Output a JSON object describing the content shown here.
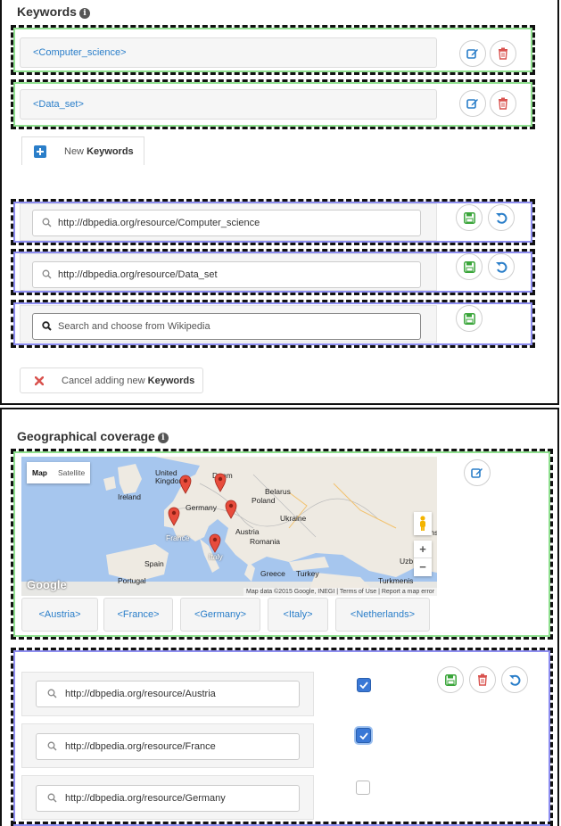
{
  "keywords": {
    "title": "Keywords",
    "items": [
      {
        "label": "<Computer_science>"
      },
      {
        "label": "<Data_set>"
      }
    ],
    "new_tab": {
      "prefix": "New",
      "bold": "Keywords"
    },
    "search_rows": [
      {
        "value": "http://dbpedia.org/resource/Computer_science",
        "placeholder": ""
      },
      {
        "value": "http://dbpedia.org/resource/Data_set",
        "placeholder": ""
      },
      {
        "value": "",
        "placeholder": "Search and choose from Wikipedia"
      }
    ],
    "cancel": {
      "prefix": "Cancel adding new",
      "bold": "Keywords"
    }
  },
  "geo": {
    "title": "Geographical coverage",
    "map": {
      "map_tab": "Map",
      "satellite_tab": "Satellite",
      "labels": {
        "ireland": "Ireland",
        "uk": "United Kingdom",
        "denmark": "Denm",
        "belarus": "Belarus",
        "poland": "Poland",
        "germany": "Germany",
        "ukraine": "Ukraine",
        "france": "France",
        "austria": "Austria",
        "romania": "Romania",
        "spain": "Spain",
        "portugal": "Portugal",
        "italy": "Italy",
        "greece": "Greece",
        "turkey": "Turkey",
        "turkmenistan": "Turkmenis",
        "uzb": "Uzb",
        "ths": "ths"
      },
      "google": "Google",
      "attribution": "Map data ©2015 Google, INEGI",
      "terms": "Terms of Use",
      "report": "Report a map error",
      "zoom_in": "+",
      "zoom_out": "−"
    },
    "chips": [
      "<Austria>",
      "<France>",
      "<Germany>",
      "<Italy>",
      "<Netherlands>"
    ],
    "edit_rows": [
      {
        "value": "http://dbpedia.org/resource/Austria",
        "checked": true
      },
      {
        "value": "http://dbpedia.org/resource/France",
        "checked": true
      },
      {
        "value": "http://dbpedia.org/resource/Germany",
        "checked": false
      }
    ]
  },
  "colors": {
    "link_blue": "#2a7ec9",
    "edit_blue": "#2a7ec9",
    "delete_red": "#d9534f",
    "save_green": "#3aa53a",
    "dash_green": "#8fe08f",
    "dash_blue": "#8d8df0"
  },
  "icons": [
    "info-icon",
    "edit-icon",
    "trash-icon",
    "plus-square-icon",
    "search-icon",
    "save-icon",
    "undo-icon",
    "close-icon",
    "map-pin-icon",
    "pegman-icon",
    "checkbox-icon"
  ]
}
